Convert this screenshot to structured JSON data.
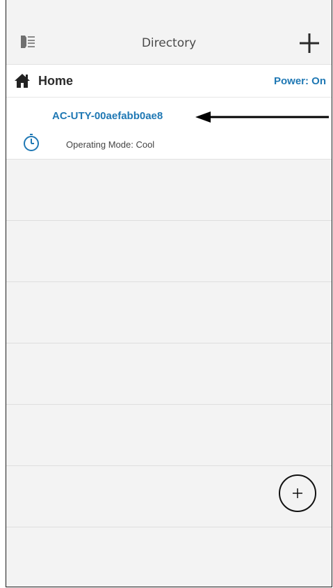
{
  "header": {
    "title": "Directory",
    "menu_icon": "list-menu-icon",
    "add_icon": "plus-icon"
  },
  "home": {
    "label": "Home",
    "icon": "home-icon",
    "power_status": "Power: On"
  },
  "device": {
    "name": "AC-UTY-00aefabb0ae8",
    "mode": "Operating Mode: Cool",
    "icon": "timer-icon"
  },
  "fab": {
    "icon": "plus-circle-icon"
  },
  "colors": {
    "accent": "#1f78b4",
    "background": "#f3f3f3",
    "row_background": "#ffffff"
  }
}
